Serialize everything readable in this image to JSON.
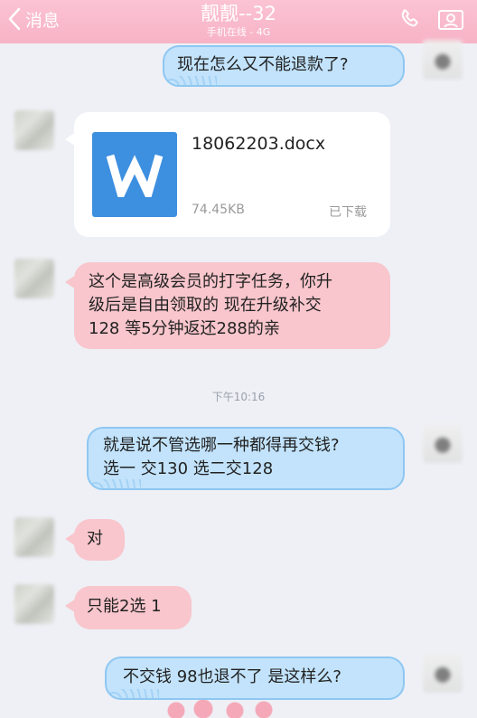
{
  "header": {
    "back_label": "消息",
    "title": "靓靓--32",
    "subtitle": "手机在线 - 4G"
  },
  "messages": [
    {
      "side": "right",
      "text": "现在怎么又不能退款了?"
    },
    {
      "side": "left",
      "type": "file",
      "file_name": "18062203.docx",
      "file_size": "74.45KB",
      "file_status": "已下载"
    },
    {
      "side": "left",
      "lines": [
        "这个是高级会员的打字任务，你升",
        "级后是自由领取的  现在升级补交",
        "128  等5分钟返还288的亲"
      ]
    },
    {
      "side": "right",
      "lines": [
        "就是说不管选哪一种都得再交钱?",
        "选一 交130  选二交128"
      ]
    },
    {
      "side": "left",
      "text": "对"
    },
    {
      "side": "left",
      "text": "只能2选 1"
    },
    {
      "side": "right",
      "text": "不交钱  98也退不了  是这样么?"
    }
  ],
  "timestamp": "下午10:16",
  "colors": {
    "header_pink": "#f7b3c6",
    "bubble_blue": "#c2e3fb",
    "bubble_pink": "#f8c6cc",
    "file_blue": "#3d8fe0"
  }
}
